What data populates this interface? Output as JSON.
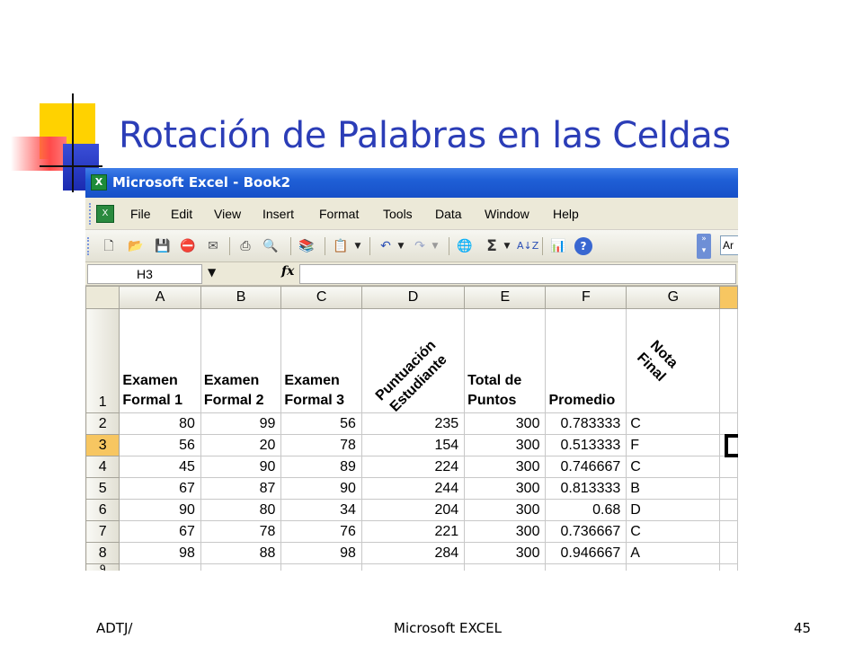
{
  "slide": {
    "title": "Rotación de Palabras en las Celdas",
    "footer_left": "ADTJ/",
    "footer_center": "Microsoft EXCEL",
    "footer_right": "45"
  },
  "window": {
    "title": "Microsoft Excel - Book2"
  },
  "menu": [
    "File",
    "Edit",
    "View",
    "Insert",
    "Format",
    "Tools",
    "Data",
    "Window",
    "Help"
  ],
  "toolbar": {
    "icons": [
      "new-icon",
      "open-icon",
      "save-icon",
      "permission-icon",
      "email-icon",
      "print-icon",
      "print-preview-icon",
      "research-icon",
      "paste-icon",
      "undo-icon",
      "redo-icon",
      "hyperlink-icon",
      "autosum-icon",
      "sort-ascending-icon",
      "chart-wizard-icon",
      "help-icon"
    ],
    "font_value": "Ar"
  },
  "formula_bar": {
    "name_box": "H3",
    "fx": "fx",
    "formula": ""
  },
  "sheet": {
    "columns": [
      "A",
      "B",
      "C",
      "D",
      "E",
      "F",
      "G"
    ],
    "active_row": "3",
    "header_row": {
      "row_num": "1",
      "A": "Examen Formal 1",
      "B": "Examen Formal 2",
      "C": "Examen Formal 3",
      "D": "Puntuación Estudiante",
      "E": "Total de Puntos",
      "F": "Promedio",
      "G": "Nota Final"
    },
    "rows": [
      {
        "n": "2",
        "A": "80",
        "B": "99",
        "C": "56",
        "D": "235",
        "E": "300",
        "F": "0.783333",
        "G": "C"
      },
      {
        "n": "3",
        "A": "56",
        "B": "20",
        "C": "78",
        "D": "154",
        "E": "300",
        "F": "0.513333",
        "G": "F"
      },
      {
        "n": "4",
        "A": "45",
        "B": "90",
        "C": "89",
        "D": "224",
        "E": "300",
        "F": "0.746667",
        "G": "C"
      },
      {
        "n": "5",
        "A": "67",
        "B": "87",
        "C": "90",
        "D": "244",
        "E": "300",
        "F": "0.813333",
        "G": "B"
      },
      {
        "n": "6",
        "A": "90",
        "B": "80",
        "C": "34",
        "D": "204",
        "E": "300",
        "F": "0.68",
        "G": "D"
      },
      {
        "n": "7",
        "A": "67",
        "B": "78",
        "C": "76",
        "D": "221",
        "E": "300",
        "F": "0.736667",
        "G": "C"
      },
      {
        "n": "8",
        "A": "98",
        "B": "88",
        "C": "98",
        "D": "284",
        "E": "300",
        "F": "0.946667",
        "G": "A"
      }
    ],
    "partial_row": "9"
  }
}
